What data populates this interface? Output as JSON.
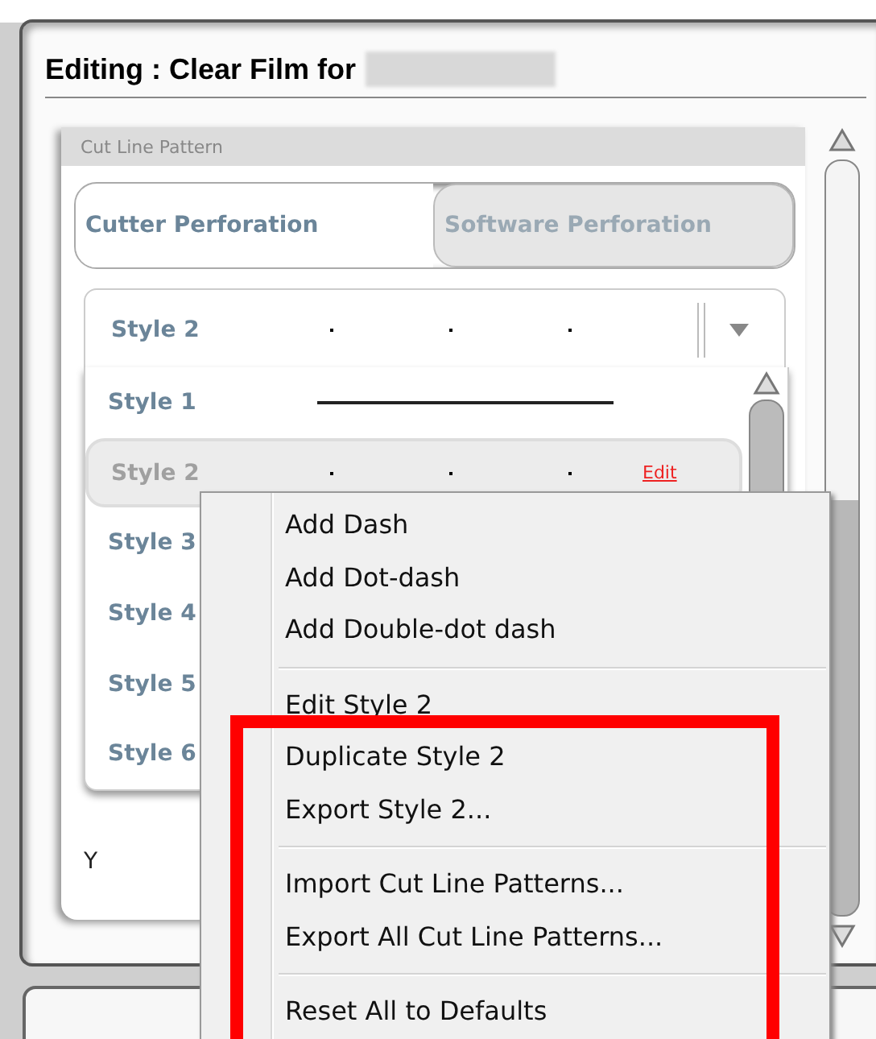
{
  "window": {
    "title": "Editing : Clear Film for",
    "title_redacted": true
  },
  "section": {
    "label": "Cut Line Pattern"
  },
  "tabs": [
    {
      "label": "Cutter Perforation",
      "selected": true
    },
    {
      "label": "Software Perforation",
      "selected": false
    }
  ],
  "combo": {
    "value": "Style 2",
    "kind": "dotted"
  },
  "style_list": [
    {
      "label": "Style 1",
      "kind": "solid",
      "selected": false
    },
    {
      "label": "Style 2",
      "kind": "dotted",
      "selected": true,
      "link": "Edit"
    },
    {
      "label": "Style 3",
      "selected": false
    },
    {
      "label": "Style 4",
      "selected": false
    },
    {
      "label": "Style 5",
      "selected": false
    },
    {
      "label": "Style 6",
      "selected": false
    }
  ],
  "field_label": "Y",
  "context_menu": [
    [
      "Add Dash",
      "Add Dot-dash",
      "Add Double-dot dash"
    ],
    [
      "Edit Style 2",
      "Duplicate Style 2",
      "Export Style 2..."
    ],
    [
      "Import Cut Line Patterns...",
      "Export All Cut Line Patterns..."
    ],
    [
      "Reset All to Defaults"
    ]
  ]
}
